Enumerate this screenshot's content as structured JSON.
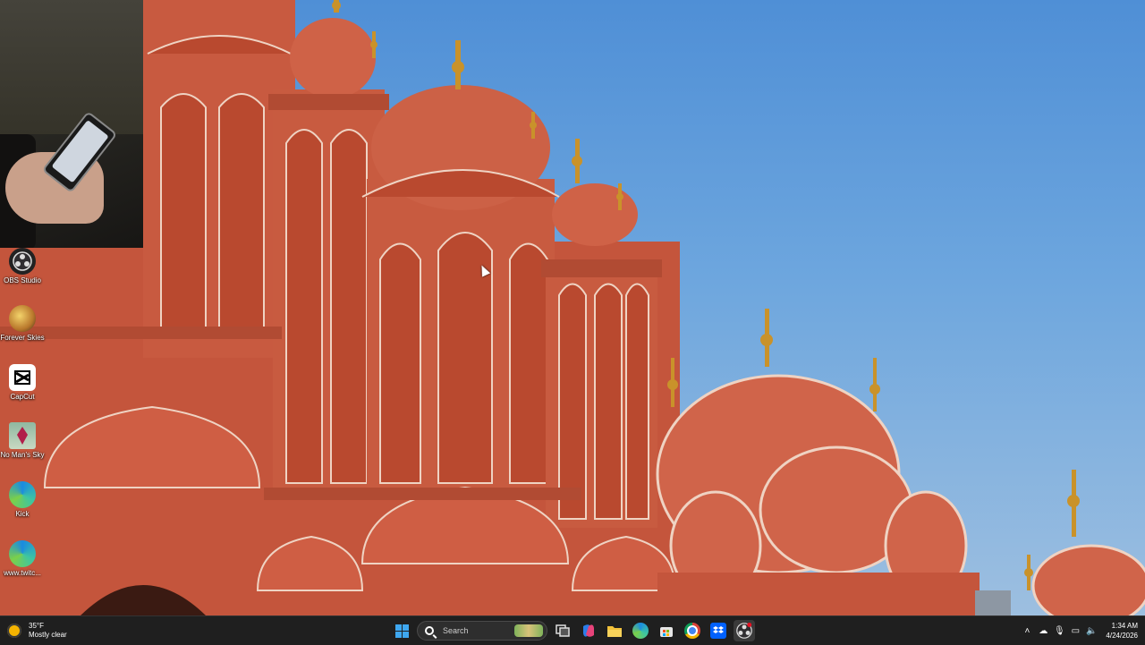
{
  "desktop_icons": [
    {
      "label": "OBS Studio",
      "icon": "obs-icon"
    },
    {
      "label": "Forever Skies",
      "icon": "forever-skies-icon"
    },
    {
      "label": "CapCut",
      "icon": "capcut-icon"
    },
    {
      "label": "No Man's Sky",
      "icon": "no-mans-sky-icon"
    },
    {
      "label": "Kick",
      "icon": "edge-shortcut-icon"
    },
    {
      "label": "www.twitc...",
      "icon": "edge-shortcut-icon"
    }
  ],
  "taskbar": {
    "weather": {
      "temp": "35°F",
      "condition": "Mostly clear"
    },
    "search_placeholder": "Search",
    "pinned": [
      "start-icon",
      "search",
      "task-view-icon",
      "copilot-icon",
      "file-explorer-icon",
      "edge-icon",
      "microsoft-store-icon",
      "chrome-icon",
      "dropbox-icon",
      "obs-taskbar-icon"
    ],
    "clock": {
      "time": "1:34 AM",
      "date": "4/24/2026"
    }
  },
  "colors": {
    "taskbar": "#1f1f1f",
    "sky": "#6da6de",
    "palace": "#c8553d",
    "accent": "#3ea7f0"
  }
}
